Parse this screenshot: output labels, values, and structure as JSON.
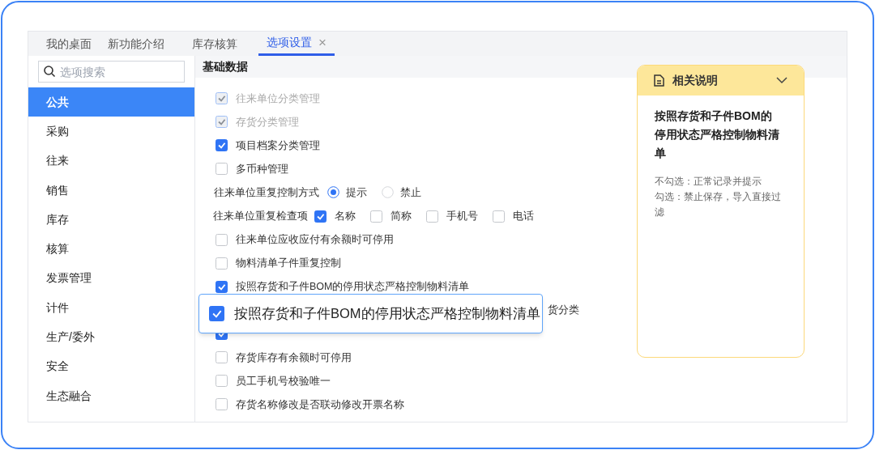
{
  "tabs": [
    {
      "label": "我的桌面",
      "selected": false
    },
    {
      "label": "新功能介绍",
      "selected": false
    },
    {
      "label": "库存核算",
      "selected": false
    },
    {
      "label": "选项设置",
      "selected": true,
      "close_icon": "×"
    }
  ],
  "sidebar": {
    "search": {
      "placeholder": "选项搜索"
    },
    "items": [
      {
        "label": "公共",
        "selected": true
      },
      {
        "label": "采购",
        "selected": false
      },
      {
        "label": "往来",
        "selected": false
      },
      {
        "label": "销售",
        "selected": false
      },
      {
        "label": "库存",
        "selected": false
      },
      {
        "label": "核算",
        "selected": false
      },
      {
        "label": "发票管理",
        "selected": false
      },
      {
        "label": "计件",
        "selected": false
      },
      {
        "label": "生产/委外",
        "selected": false
      },
      {
        "label": "安全",
        "selected": false
      },
      {
        "label": "生态融合",
        "selected": false
      }
    ]
  },
  "section_title": "基础数据",
  "options": [
    {
      "kind": "checkbox",
      "label": "往来单位分类管理",
      "checked": true,
      "disabled": true
    },
    {
      "kind": "checkbox",
      "label": "存货分类管理",
      "checked": true,
      "disabled": true
    },
    {
      "kind": "checkbox",
      "label": "项目档案分类管理",
      "checked": true,
      "disabled": false
    },
    {
      "kind": "checkbox",
      "label": "多币种管理",
      "checked": false,
      "disabled": false
    },
    {
      "kind": "radio",
      "label": "往来单位重复控制方式",
      "choices": [
        {
          "label": "提示",
          "selected": true
        },
        {
          "label": "禁止",
          "selected": false
        }
      ]
    },
    {
      "kind": "multi",
      "label": "往来单位重复检查项",
      "choices": [
        {
          "label": "名称",
          "checked": true
        },
        {
          "label": "简称",
          "checked": false
        },
        {
          "label": "手机号",
          "checked": false
        },
        {
          "label": "电话",
          "checked": false
        }
      ]
    },
    {
      "kind": "checkbox",
      "label": "往来单位应收应付有余额时可停用",
      "checked": false,
      "disabled": false
    },
    {
      "kind": "checkbox",
      "label": "物料清单子件重复控制",
      "checked": false,
      "disabled": false
    },
    {
      "kind": "checkbox",
      "label": "按照存货和子件BOM的停用状态严格控制物料清单",
      "checked": true,
      "disabled": false
    },
    {
      "kind": "partial",
      "label": "货分类"
    },
    {
      "kind": "covered",
      "checked": true
    },
    {
      "kind": "checkbox",
      "label": "存货库存有余额时可停用",
      "checked": false,
      "disabled": false
    },
    {
      "kind": "checkbox",
      "label": "员工手机号校验唯一",
      "checked": false,
      "disabled": false
    },
    {
      "kind": "checkbox",
      "label": "存货名称修改是否联动修改开票名称",
      "checked": false,
      "disabled": false
    }
  ],
  "callout": {
    "label": "按照存货和子件BOM的停用状态严格控制物料清单",
    "checked": true
  },
  "help_panel": {
    "title": "相关说明",
    "heading": "按照存货和子件BOM的停用状态严格控制物料清单",
    "lines": [
      "不勾选：正常记录并提示",
      "勾选：禁止保存，导入直接过滤"
    ]
  }
}
